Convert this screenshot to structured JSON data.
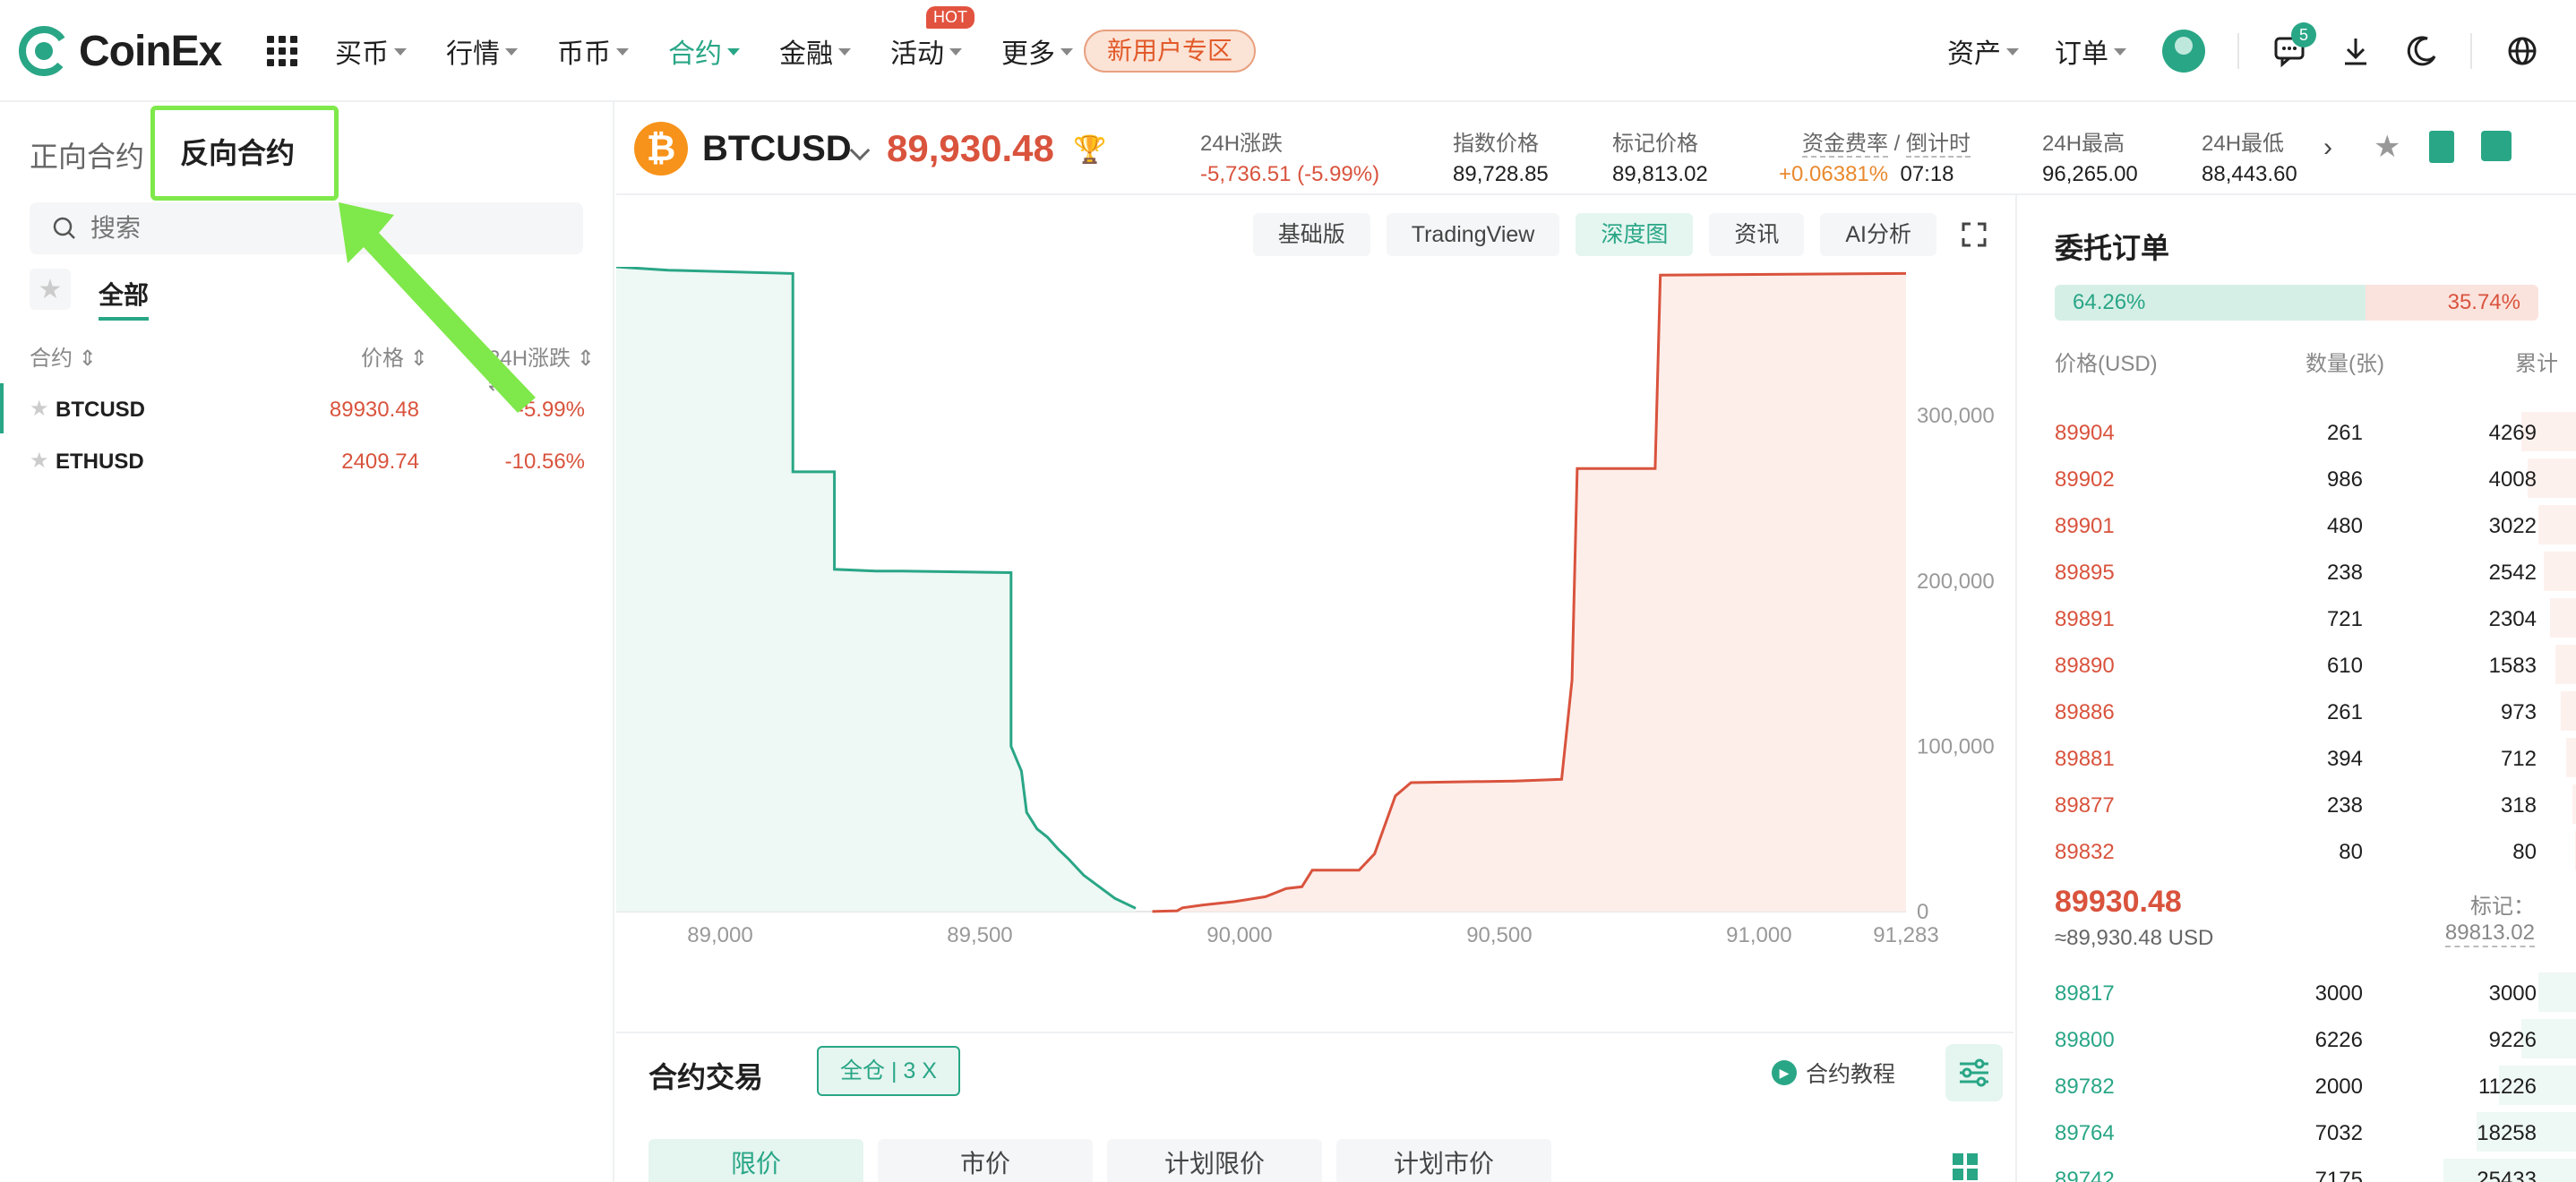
{
  "nav": {
    "logo_text": "CoinEx",
    "items": [
      {
        "label": "买币",
        "caret": true
      },
      {
        "label": "行情",
        "caret": true
      },
      {
        "label": "币币",
        "caret": true
      },
      {
        "label": "合约",
        "caret": true,
        "active": true
      },
      {
        "label": "金融",
        "caret": true
      },
      {
        "label": "活动",
        "caret": true,
        "badge": "HOT"
      },
      {
        "label": "更多",
        "caret": true
      }
    ],
    "new_user": "新用户专区",
    "assets": "资产",
    "orders": "订单",
    "notification_count": "5",
    "icons": [
      "grid-icon",
      "avatar",
      "message-icon",
      "download-icon",
      "moon-icon",
      "globe-icon"
    ]
  },
  "left": {
    "tab_normal": "正向合约",
    "tab_inverse": "反向合约",
    "search_placeholder": "搜索",
    "filter_all": "全部",
    "col_contract": "合约",
    "col_price": "价格",
    "col_change": "24H涨跌",
    "markets": [
      {
        "symbol": "BTCUSD",
        "price": "89930.48",
        "change": "-5.99%",
        "active": true
      },
      {
        "symbol": "ETHUSD",
        "price": "2409.74",
        "change": "-10.56%",
        "active": false
      }
    ]
  },
  "ticker": {
    "pair": "BTCUSD",
    "last_price": "89,930.48",
    "change_label": "24H涨跌",
    "change_value": "-5,736.51 (-5.99%)",
    "index_label": "指数价格",
    "index_value": "89,728.85",
    "mark_label": "标记价格",
    "mark_value": "89,813.02",
    "funding_label": "资金费率",
    "countdown_label": "倒计时",
    "funding_value": "+0.06381%",
    "countdown_value": "07:18",
    "high_label": "24H最高",
    "high_value": "96,265.00",
    "low_label": "24H最低",
    "low_value": "88,443.60"
  },
  "chart_tabs": [
    {
      "label": "基础版",
      "active": false
    },
    {
      "label": "TradingView",
      "active": false
    },
    {
      "label": "深度图",
      "active": true
    },
    {
      "label": "资讯",
      "active": false
    },
    {
      "label": "AI分析",
      "active": false
    }
  ],
  "chart_data": {
    "type": "area",
    "x_ticks": [
      "89,000",
      "89,500",
      "90,000",
      "90,500",
      "91,000",
      "91,283"
    ],
    "y_ticks": [
      "0",
      "100,000",
      "200,000",
      "300,000"
    ],
    "xlim": [
      88800,
      91283
    ],
    "ylim": [
      0,
      390000
    ],
    "series": [
      {
        "side": "bid",
        "color": "#29a686",
        "x": [
          88800,
          88900,
          89140,
          89140,
          89220,
          89220,
          89300,
          89350,
          89560,
          89560,
          89580,
          89590,
          89610,
          89630,
          89650,
          89670,
          89700,
          89730,
          89760,
          89800
        ],
        "y": [
          390000,
          388000,
          386000,
          266000,
          266000,
          207000,
          206000,
          206000,
          205000,
          100000,
          85000,
          60000,
          50000,
          45000,
          38000,
          32000,
          22000,
          15000,
          8000,
          2000
        ]
      },
      {
        "side": "ask",
        "color": "#d9533d",
        "x": [
          89832,
          89880,
          89890,
          89930,
          89990,
          90050,
          90090,
          90120,
          90140,
          90230,
          90260,
          90300,
          90330,
          90530,
          90620,
          90640,
          90650,
          90800,
          90810,
          91283
        ],
        "y": [
          80,
          500,
          2300,
          4000,
          6000,
          9000,
          14000,
          15000,
          25000,
          25000,
          35000,
          70000,
          78000,
          79000,
          80000,
          140000,
          268000,
          268000,
          385000,
          386000
        ]
      }
    ]
  },
  "trade": {
    "title": "合约交易",
    "margin_mode": "全仓",
    "leverage": "3 X",
    "tutorial": "合约教程",
    "order_types": [
      "限价",
      "市价",
      "计划限价",
      "计划市价"
    ]
  },
  "orderbook": {
    "title": "委托订单",
    "buy_ratio": "64.26%",
    "sell_ratio": "35.74%",
    "buy_fraction": 0.6426,
    "col_price": "价格(USD)",
    "col_qty": "数量(张)",
    "col_total": "累计",
    "asks": [
      {
        "price": "89904",
        "qty": "261",
        "total": "4269",
        "depth": 0.1
      },
      {
        "price": "89902",
        "qty": "986",
        "total": "4008",
        "depth": 0.09
      },
      {
        "price": "89901",
        "qty": "480",
        "total": "3022",
        "depth": 0.07
      },
      {
        "price": "89895",
        "qty": "238",
        "total": "2542",
        "depth": 0.06
      },
      {
        "price": "89891",
        "qty": "721",
        "total": "2304",
        "depth": 0.05
      },
      {
        "price": "89890",
        "qty": "610",
        "total": "1583",
        "depth": 0.04
      },
      {
        "price": "89886",
        "qty": "261",
        "total": "973",
        "depth": 0.03
      },
      {
        "price": "89881",
        "qty": "394",
        "total": "712",
        "depth": 0.02
      },
      {
        "price": "89877",
        "qty": "238",
        "total": "318",
        "depth": 0.01
      },
      {
        "price": "89832",
        "qty": "80",
        "total": "80",
        "depth": 0.005
      }
    ],
    "mid_price": "89930.48",
    "mid_usd": "≈89,930.48  USD",
    "mark_label": "标记：",
    "mark_value": "89813.02",
    "bids": [
      {
        "price": "89817",
        "qty": "3000",
        "total": "3000",
        "depth": 0.07
      },
      {
        "price": "89800",
        "qty": "6226",
        "total": "9226",
        "depth": 0.1
      },
      {
        "price": "89782",
        "qty": "2000",
        "total": "11226",
        "depth": 0.14
      },
      {
        "price": "89764",
        "qty": "7032",
        "total": "18258",
        "depth": 0.18
      },
      {
        "price": "89742",
        "qty": "7175",
        "total": "25433",
        "depth": 0.24
      }
    ]
  }
}
